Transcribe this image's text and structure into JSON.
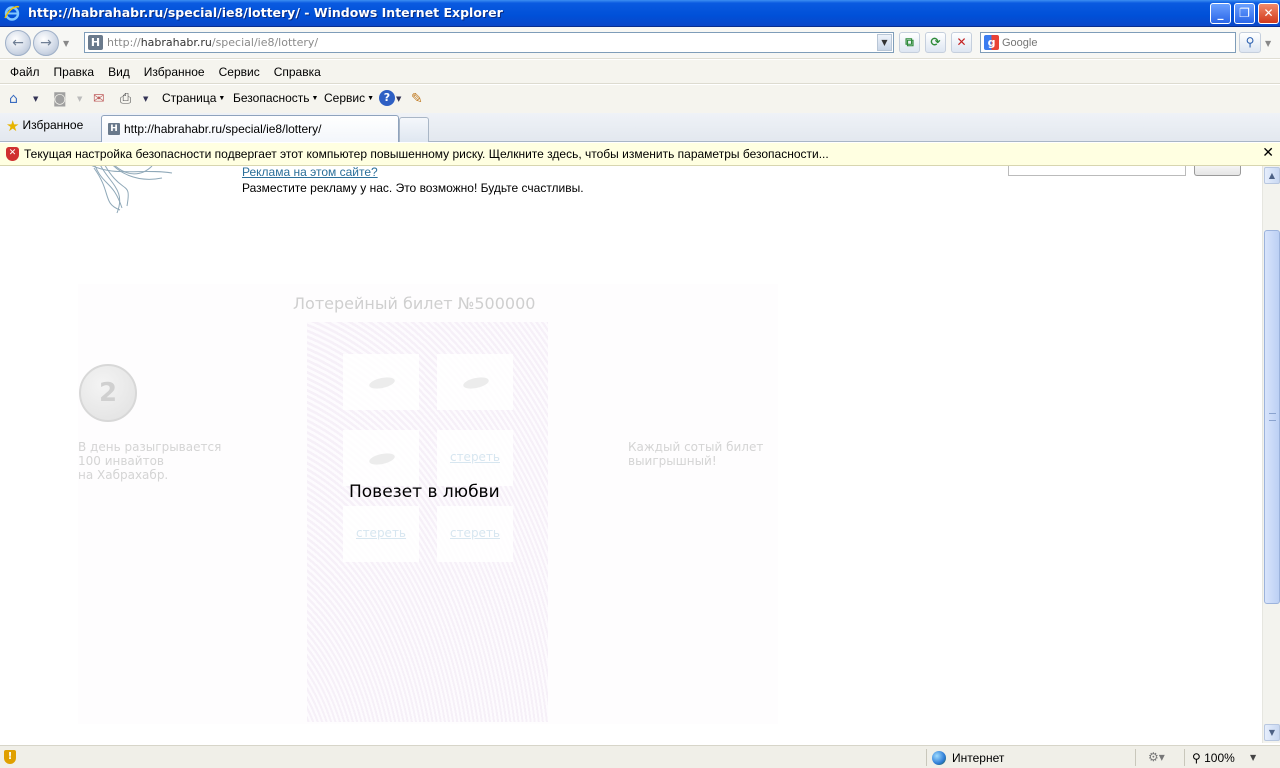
{
  "window": {
    "title": "http://habrahabr.ru/special/ie8/lottery/ - Windows Internet Explorer",
    "minimize_icon": "minimize-icon",
    "maximize_icon": "restore-icon",
    "close_icon": "close-icon"
  },
  "navigation": {
    "address_prefix": "http://",
    "address_host": "habrahabr.ru",
    "address_path": "/special/ie8/lottery/",
    "search_placeholder": "Google"
  },
  "menubar": {
    "items": [
      "Файл",
      "Правка",
      "Вид",
      "Избранное",
      "Сервис",
      "Справка"
    ]
  },
  "commandbar": {
    "page_label": "Страница",
    "security_label": "Безопасность",
    "tools_label": "Сервис",
    "help_icon": "?"
  },
  "tabs": {
    "favorites_label": "Избранное",
    "active_tab_label": "http://habrahabr.ru/special/ie8/lottery/"
  },
  "infobar": {
    "message": "Текущая настройка безопасности подвергает этот компьютер повышенному риску. Щелкните здесь, чтобы изменить параметры безопасности...",
    "close_glyph": "✕"
  },
  "page": {
    "ad_link": "Реклама на этом сайте?",
    "ad_text": "Разместите рекламу у нас. Это возможно! Будьте счастливы.",
    "ticket_title": "Лотерейный билет №500000",
    "coin_label": "2",
    "left_text": "В день разыгрывается\n100 инвайтов\nна Хабрахабр.",
    "right_text": "Каждый сотый билет\nвыигрышный!",
    "erase_label": "стереть",
    "result_text": "Повезет в любви"
  },
  "statusbar": {
    "zone_label": "Интернет",
    "zoom_label": "100%"
  },
  "colors": {
    "titlebar": "#0050d8",
    "link": "#2b6f9a",
    "infobar_bg": "#ffffe1"
  }
}
